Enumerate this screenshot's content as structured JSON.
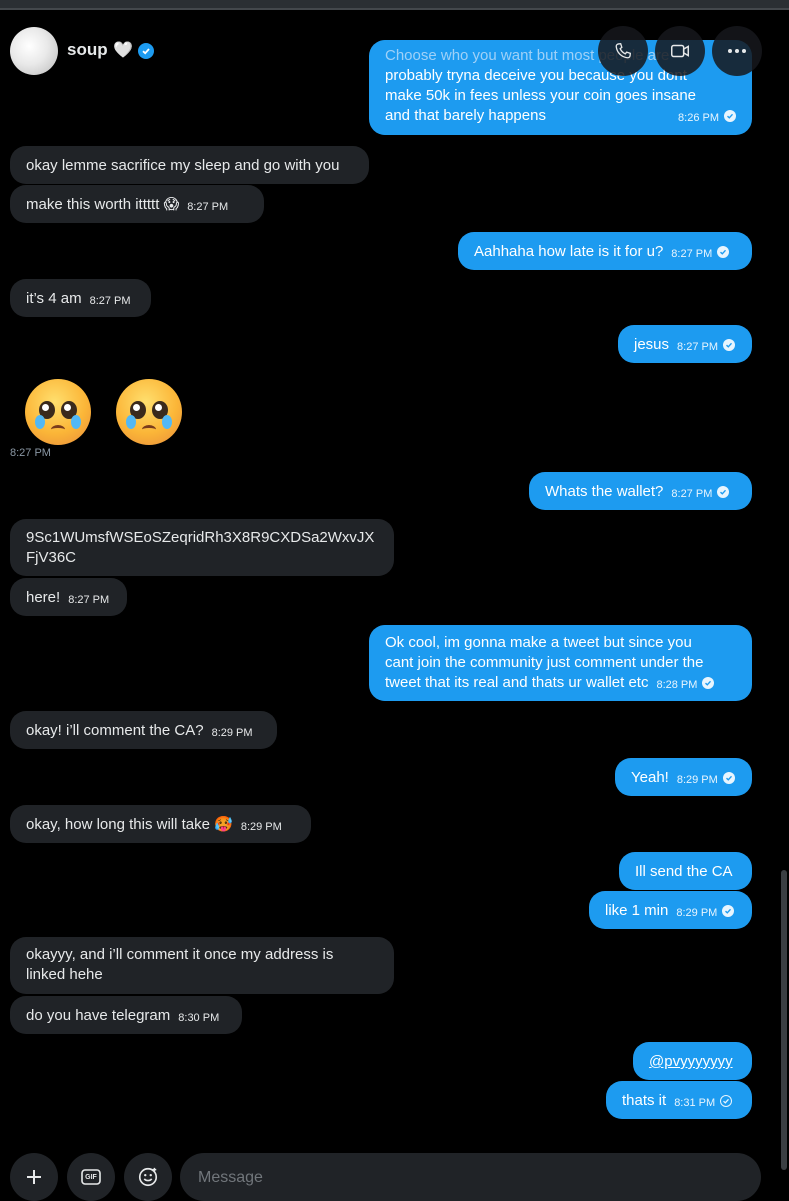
{
  "header": {
    "username": "soup",
    "heart_emoji": "🤍",
    "icons": [
      "avatar",
      "verified-badge-icon",
      "phone-icon",
      "video-icon",
      "more-icon"
    ]
  },
  "messages": [
    {
      "id": "m1",
      "side": "out",
      "lines": [
        "Choose who you want but most people are",
        "probably tryna deceive you because you dont",
        "make 50k in fees unless your coin goes insane",
        "and that barely happens"
      ],
      "time": "8:26 PM"
    },
    {
      "id": "m2",
      "side": "in",
      "text": "okay lemme sacrifice my sleep and go with you"
    },
    {
      "id": "m3",
      "side": "in",
      "text": "make this worth ittttt 😱",
      "time": "8:27 PM"
    },
    {
      "id": "m4",
      "side": "out",
      "text": "Aahhaha how late is it for u?",
      "time": "8:27 PM"
    },
    {
      "id": "m5",
      "side": "in",
      "text": "it’s 4 am",
      "time": "8:27 PM"
    },
    {
      "id": "m6",
      "side": "out",
      "text": "jesus",
      "time": "8:27 PM"
    },
    {
      "id": "m7",
      "side": "in",
      "emojis": [
        "🥹",
        "🥹"
      ],
      "time": "8:27 PM"
    },
    {
      "id": "m8",
      "side": "out",
      "text": "Whats the wallet?",
      "time": "8:27 PM"
    },
    {
      "id": "m9",
      "side": "in",
      "lines": [
        "9Sc1WUmsfWSEoSZeqridRh3X8R9CXDSa2WxvJX",
        "FjV36C"
      ]
    },
    {
      "id": "m10",
      "side": "in",
      "text": "here!",
      "time": "8:27 PM"
    },
    {
      "id": "m11",
      "side": "out",
      "lines": [
        "Ok cool, im gonna make a tweet but since you",
        "cant join the community just comment under the",
        "tweet that its real and thats ur wallet etc"
      ],
      "time": "8:28 PM"
    },
    {
      "id": "m12",
      "side": "in",
      "text": "okay! i’ll comment the CA?",
      "time": "8:29 PM"
    },
    {
      "id": "m13",
      "side": "out",
      "text": "Yeah!",
      "time": "8:29 PM"
    },
    {
      "id": "m14",
      "side": "in",
      "text": "okay, how long this will take 🥵",
      "time": "8:29 PM"
    },
    {
      "id": "m15",
      "side": "out",
      "text": "Ill send the CA"
    },
    {
      "id": "m16",
      "side": "out",
      "text": "like 1 min",
      "time": "8:29 PM"
    },
    {
      "id": "m17",
      "side": "in",
      "lines": [
        "okayyy, and i’ll comment it once my address is",
        "linked hehe"
      ]
    },
    {
      "id": "m18",
      "side": "in",
      "text": "do you have telegram",
      "time": "8:30 PM"
    },
    {
      "id": "m19",
      "side": "out",
      "text": "@pvyyyyyyy"
    },
    {
      "id": "m20",
      "side": "out",
      "text": "thats it",
      "time": "8:31 PM"
    }
  ],
  "composer": {
    "placeholder": "Message",
    "gif_label": "GIF",
    "icons": [
      "plus-icon",
      "gif-icon",
      "emoji-icon"
    ]
  },
  "colors": {
    "background": "#000000",
    "outgoing_bubble": "#1d9bf0",
    "incoming_bubble": "#202327",
    "verified": "#1d9bf0"
  }
}
